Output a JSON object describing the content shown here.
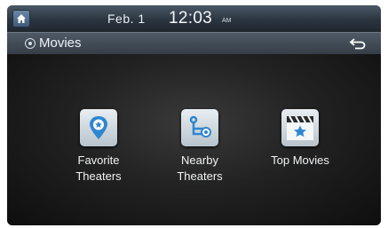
{
  "status_bar": {
    "date": "Feb.  1",
    "time": "12:03",
    "ampm": "AM"
  },
  "title_bar": {
    "title": "Movies"
  },
  "menu": [
    {
      "line1": "Favorite",
      "line2": "Theaters",
      "icon": "location-pin-star-icon"
    },
    {
      "line1": "Nearby",
      "line2": "Theaters",
      "icon": "route-nearby-icon"
    },
    {
      "line1": "Top Movies",
      "line2": "",
      "icon": "clapperboard-star-icon"
    }
  ],
  "colors": {
    "accent_blue": "#2f86cf",
    "status_bar": "#2b3540",
    "tile": "#d5dde4"
  }
}
